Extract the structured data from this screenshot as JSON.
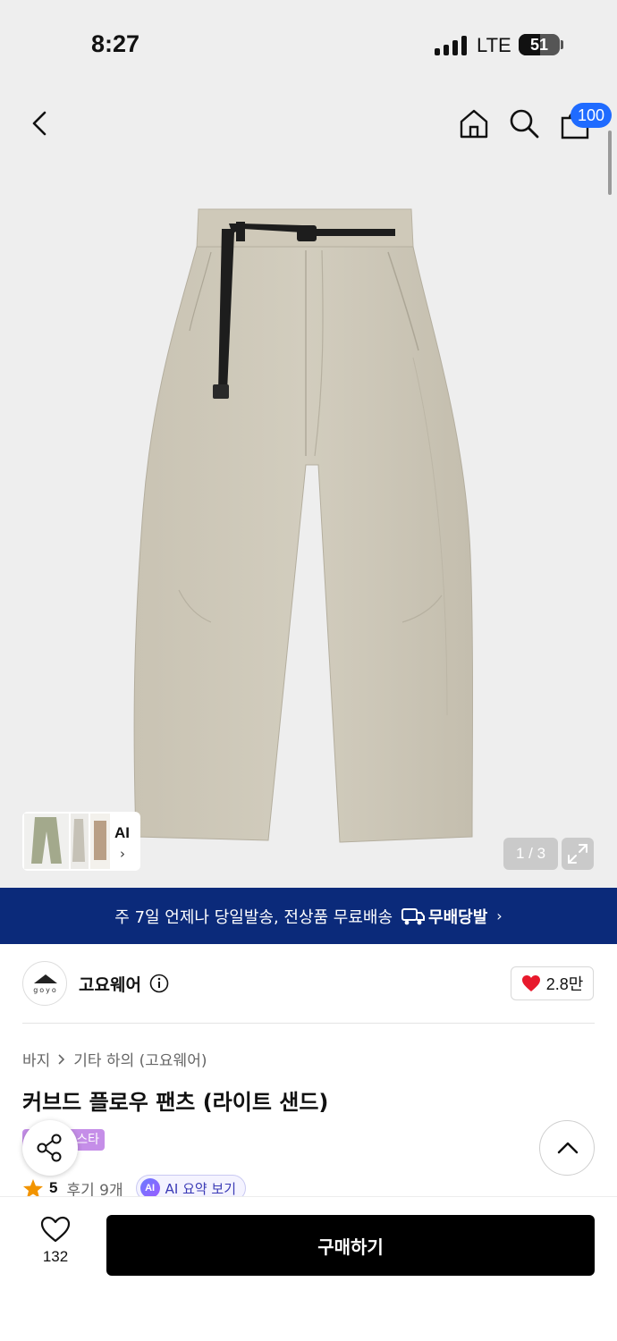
{
  "status_bar": {
    "time": "8:27",
    "network": "LTE",
    "battery": "51"
  },
  "nav": {
    "back_icon": "chevron-left-icon",
    "home_icon": "home-icon",
    "search_icon": "search-icon",
    "cart_icon": "shopping-bag-icon",
    "cart_badge": "100"
  },
  "gallery": {
    "counter": "1 / 3",
    "ai_label": "AI",
    "chevron": "›"
  },
  "banner": {
    "text": "주 7일 언제나 당일발송, 전상품 무료배송",
    "logo_text": "무배당발",
    "chevron": "›"
  },
  "brand": {
    "name": "고요웨어",
    "logo_text": "goyo",
    "likes": "2.8만"
  },
  "breadcrumb": {
    "category": "바지",
    "sub_category": "기타 하의 (고요웨어)"
  },
  "product": {
    "title": "커브드 플로우 팬츠 (라이트 샌드)",
    "badge": "스타"
  },
  "rating": {
    "score": "5",
    "reviews": "후기 9개",
    "ai_summary": "AI 요약 보기",
    "ai_badge": "AI"
  },
  "bottom": {
    "wishlist_count": "132",
    "buy_label": "구매하기"
  },
  "colors": {
    "accent_blue": "#1f6bff",
    "banner_navy": "#0b2a7a",
    "heart_red": "#e8192c",
    "star_orange": "#f29400",
    "pants_beige": "#cdc8b8"
  }
}
